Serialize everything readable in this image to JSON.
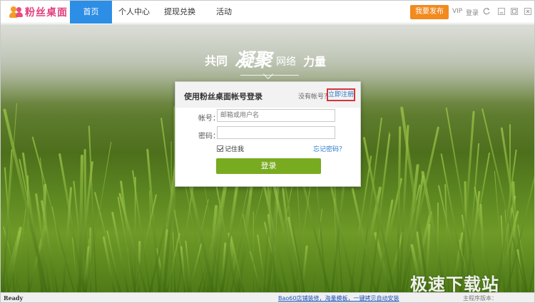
{
  "app": {
    "logo_text": "粉丝桌面",
    "nav_tabs": [
      {
        "label": "首页",
        "active": true
      },
      {
        "label": "个人中心",
        "active": false
      },
      {
        "label": "提现兑换",
        "active": false
      },
      {
        "label": "活动",
        "active": false
      }
    ],
    "publish_label": "我要发布",
    "vip_label": "VIP",
    "login_label": "登录",
    "icons": [
      "refresh-icon",
      "minimize-icon",
      "restore-icon",
      "close-icon"
    ]
  },
  "banner": {
    "slogan_part1": "共同",
    "slogan_part2": "凝聚",
    "slogan_part3": "网络",
    "slogan_part4": "力量"
  },
  "login": {
    "title": "使用粉丝桌面帐号登录",
    "no_account": "没有帐号？",
    "register_link": "立即注册",
    "account_label": "帐号：",
    "account_placeholder": "邮箱或用户名",
    "password_label": "密码：",
    "password_placeholder": "",
    "remember_label": "记住我",
    "remember_checked": true,
    "forgot_link": "忘记密码？",
    "submit_label": "登录"
  },
  "status": {
    "ready": "Ready",
    "ad_link": "Bao60店铺装修，海量模板，一键拷贝自动安装",
    "version": "主程序版本：1.1.0.082218093430"
  },
  "watermark": "极速下载站",
  "colors": {
    "nav_active": "#2d8ee6",
    "publish_button": "#f28a1e",
    "login_button": "#78ab1f",
    "register_highlight": "#d7343b",
    "link": "#2a78c9"
  }
}
